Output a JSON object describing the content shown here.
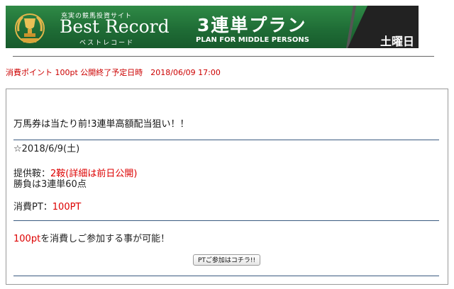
{
  "banner": {
    "logo_sub": "充実の競馬投資サイト",
    "logo_main": "Best Record",
    "logo_kana": "ベストレコード",
    "plan_title": "3連単プラン",
    "plan_sub": "PLAN FOR MIDDLE PERSONS",
    "day": "土曜日",
    "colors": {
      "green": "#1f6d36",
      "dark": "#222222",
      "gold": "#d9a53a"
    }
  },
  "meta": "消費ポイント 100pt 公開終了予定日時　2018/06/09 17:00",
  "content": {
    "headline": "万馬券は当たり前!3連単高額配当狙い！！",
    "date": "☆2018/6/9(土)",
    "provide_label": "提供鞍：",
    "provide_value": "2鞍(詳細は前日公開)",
    "bet_text": "勝負は3連単60点",
    "cost_label": "消費PT：",
    "cost_value": "100PT",
    "notice_red": "100pt",
    "notice_rest": "を消費しご参加する事が可能！",
    "join_button": "PTご参加はコチラ!!"
  }
}
